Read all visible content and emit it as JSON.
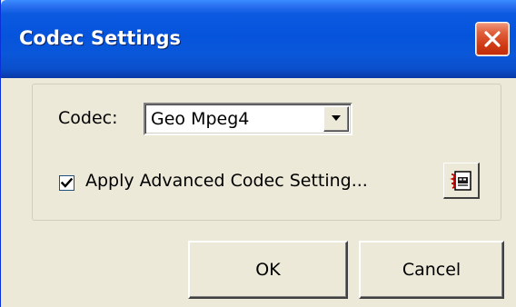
{
  "window": {
    "title": "Codec Settings"
  },
  "codec": {
    "label": "Codec:",
    "selected_value": "Geo Mpeg4"
  },
  "advanced": {
    "checked": true,
    "label": "Apply Advanced Codec Setting..."
  },
  "buttons": {
    "ok_label": "OK",
    "cancel_label": "Cancel"
  },
  "colors": {
    "titlebar": "#0654dc",
    "dialog_bg": "#ece9d8",
    "close_button": "#d04a20"
  },
  "icons": {
    "close": "close-icon",
    "dropdown": "chevron-down-icon",
    "checkbox": "checkmark-icon",
    "settings": "codec-settings-icon"
  }
}
